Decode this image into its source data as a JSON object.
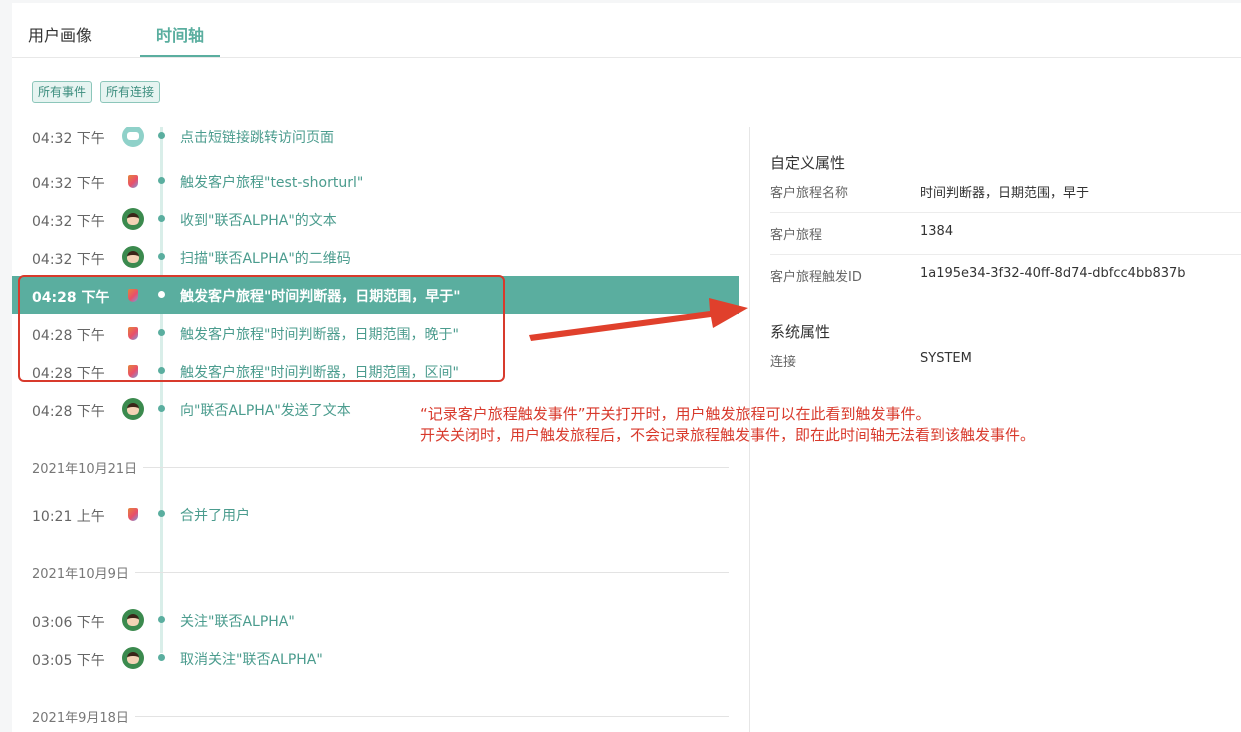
{
  "tabs": [
    {
      "label": "用户画像"
    },
    {
      "label": "时间轴"
    }
  ],
  "filters": [
    {
      "label": "所有事件"
    },
    {
      "label": "所有连接"
    }
  ],
  "timeline": {
    "events": [
      {
        "time": "04:32 下午",
        "text": "点击短链接跳转访问页面",
        "icon": "bot-icon"
      },
      {
        "time": "04:32 下午",
        "text": "触发客户旅程\"test-shorturl\"",
        "icon": "journey-icon"
      },
      {
        "time": "04:32 下午",
        "text": "收到\"联否ALPHA\"的文本",
        "icon": "user-avatar"
      },
      {
        "time": "04:32 下午",
        "text": "扫描\"联否ALPHA\"的二维码",
        "icon": "user-avatar"
      },
      {
        "time": "04:28 下午",
        "text": "触发客户旅程\"时间判断器，日期范围，早于\"",
        "icon": "journey-icon",
        "selected": true
      },
      {
        "time": "04:28 下午",
        "text": "触发客户旅程\"时间判断器，日期范围，晚于\"",
        "icon": "journey-icon"
      },
      {
        "time": "04:28 下午",
        "text": "触发客户旅程\"时间判断器，日期范围，区间\"",
        "icon": "journey-icon"
      },
      {
        "time": "04:28 下午",
        "text": "向\"联否ALPHA\"发送了文本",
        "icon": "user-avatar"
      }
    ],
    "date1": "2021年10月21日",
    "events2": [
      {
        "time": "10:21 上午",
        "text": "合并了用户",
        "icon": "journey-icon"
      }
    ],
    "date2": "2021年10月9日",
    "events3": [
      {
        "time": "03:06 下午",
        "text": "关注\"联否ALPHA\"",
        "icon": "user-avatar"
      },
      {
        "time": "03:05 下午",
        "text": "取消关注\"联否ALPHA\"",
        "icon": "user-avatar"
      }
    ],
    "date3": "2021年9月18日"
  },
  "details": {
    "custom_title": "自定义属性",
    "custom": [
      {
        "key": "客户旅程名称",
        "value": "时间判断器，日期范围，早于"
      },
      {
        "key": "客户旅程",
        "value": "1384"
      },
      {
        "key": "客户旅程触发ID",
        "value": "1a195e34-3f32-40ff-8d74-dbfcc4bb837b"
      }
    ],
    "system_title": "系统属性",
    "system": [
      {
        "key": "连接",
        "value": "SYSTEM"
      }
    ]
  },
  "annotation": {
    "line1": "“记录客户旅程触发事件”开关打开时，用户触发旅程可以在此看到触发事件。",
    "line2": "开关关闭时，用户触发旅程后，不会记录旅程触发事件，即在此时间轴无法看到该触发事件。"
  },
  "colors": {
    "accent": "#5aae9f",
    "annotation_red": "#d83a2c"
  }
}
